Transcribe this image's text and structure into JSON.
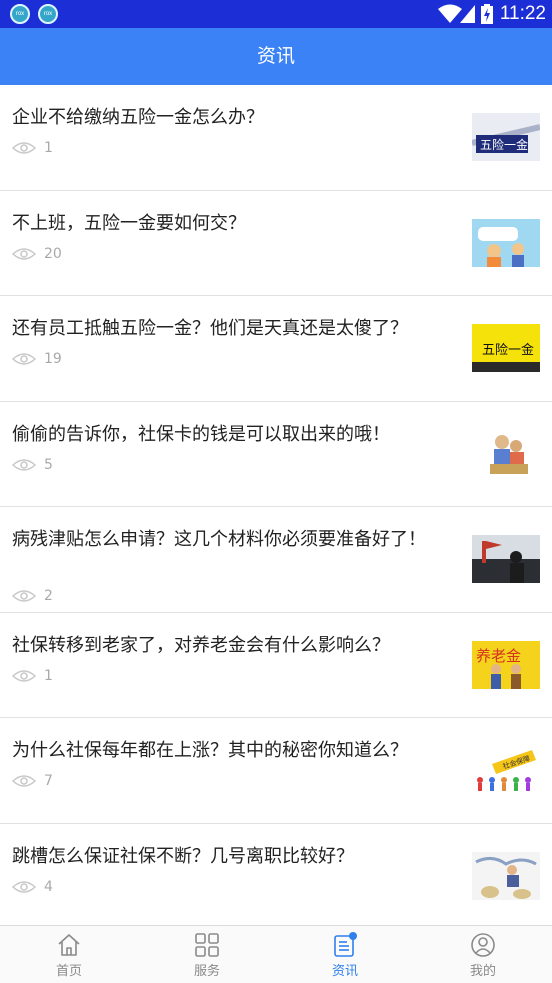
{
  "status_bar": {
    "time": "11:22",
    "app_icon_text": "rox"
  },
  "header": {
    "title": "资讯"
  },
  "articles": [
    {
      "title": "企业不给缴纳五险一金怎么办？",
      "views": "1"
    },
    {
      "title": "不上班，五险一金要如何交？",
      "views": "20"
    },
    {
      "title": "还有员工抵触五险一金？他们是天真还是太傻了？",
      "views": "19"
    },
    {
      "title": "偷偷的告诉你，社保卡的钱是可以取出来的哦！",
      "views": "5"
    },
    {
      "title": "病残津贴怎么申请？这几个材料你必须要准备好了！",
      "views": "2"
    },
    {
      "title": "社保转移到老家了，对养老金会有什么影响么？",
      "views": "1"
    },
    {
      "title": "为什么社保每年都在上涨？其中的秘密你知道么？",
      "views": "7"
    },
    {
      "title": "跳槽怎么保证社保不断？几号离职比较好？",
      "views": "4"
    }
  ],
  "thumb_text": {
    "t1": "五险一金",
    "t3": "五险一金",
    "t6": "养老金",
    "t7": "社会保障"
  },
  "tabs": [
    {
      "label": "首页",
      "icon": "home-icon"
    },
    {
      "label": "服务",
      "icon": "grid-icon"
    },
    {
      "label": "资讯",
      "icon": "news-icon",
      "active": true
    },
    {
      "label": "我的",
      "icon": "user-icon"
    }
  ],
  "colors": {
    "status_bar": "#1c2fd6",
    "header": "#3b82f6",
    "active_tab": "#2f80ed",
    "inactive_tab": "#8a8a8a"
  }
}
